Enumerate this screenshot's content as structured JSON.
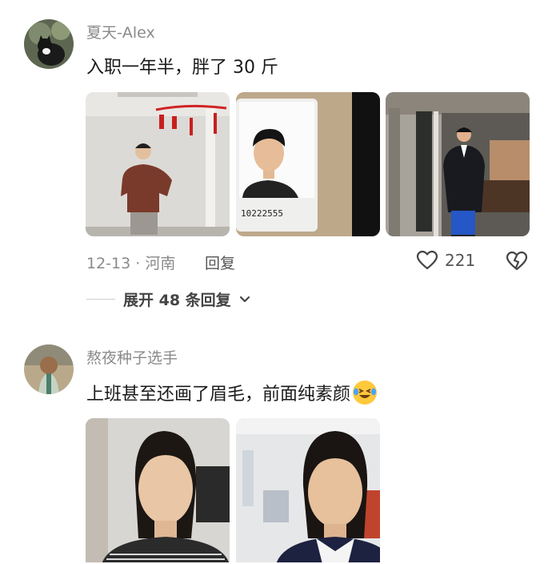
{
  "comments": [
    {
      "username": "夏天-Alex",
      "text": "入职一年半，胖了 30 斤",
      "photo_card_number": "10222555",
      "meta": "12-13 · 河南",
      "reply_label": "回复",
      "like_count": "221",
      "expand_label": "展开 48 条回复"
    },
    {
      "username": "熬夜种子选手",
      "text": "上班甚至还画了眉毛，前面纯素颜"
    }
  ],
  "icons": [
    "heart-icon",
    "broken-heart-icon",
    "chevron-down-icon",
    "laughing-tears-emoji"
  ],
  "colors": {
    "secondary_text": "#8a8a8a",
    "emoji": "#ffc93c"
  }
}
